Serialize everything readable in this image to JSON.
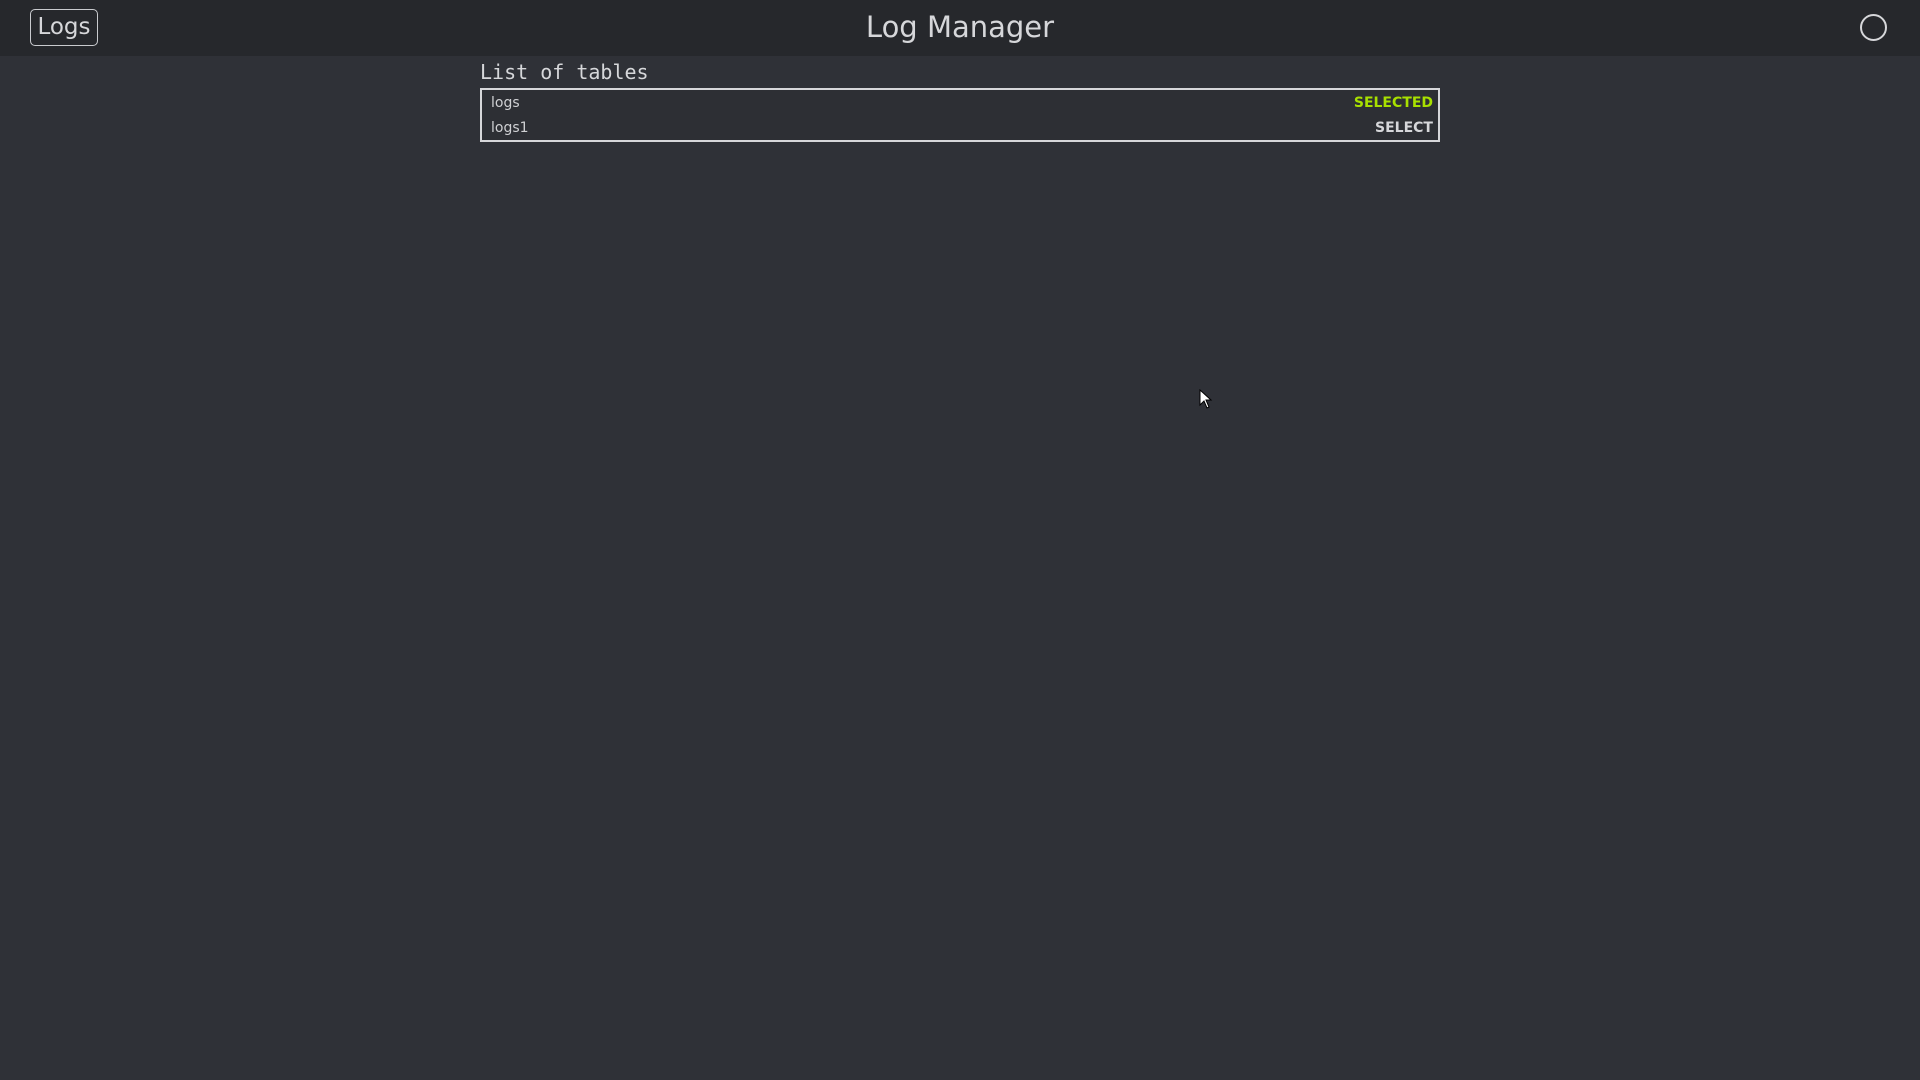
{
  "header": {
    "logs_button_label": "Logs",
    "title": "Log Manager",
    "status_icon": "circle-icon"
  },
  "tables_section": {
    "title": "List of tables",
    "rows": [
      {
        "name": "logs",
        "action": "SELECTED"
      },
      {
        "name": "logs1",
        "action": "SELECT"
      }
    ]
  },
  "colors": {
    "background": "#2f3137",
    "header_background": "#26282c",
    "selected_accent": "#a8e000",
    "text": "#d6d7da"
  }
}
